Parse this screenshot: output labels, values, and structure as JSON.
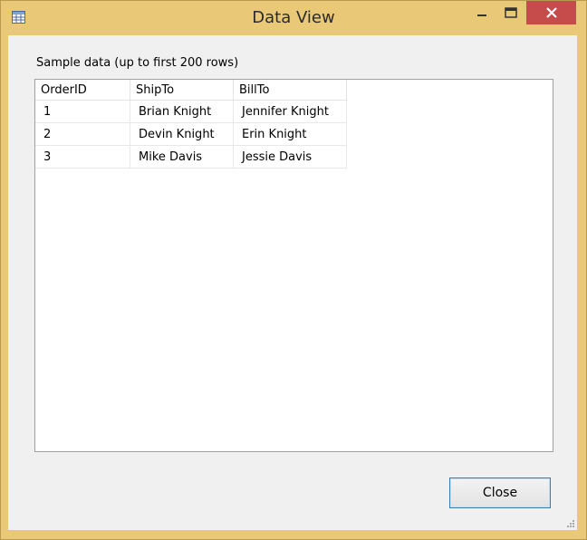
{
  "window": {
    "title": "Data View",
    "frame_color": "#e9c878",
    "close_color": "#c64b4b"
  },
  "content": {
    "caption": "Sample data (up to first 200 rows)"
  },
  "table": {
    "columns": [
      "OrderID",
      "ShipTo",
      "BillTo"
    ],
    "rows": [
      [
        "1",
        "Brian Knight",
        "Jennifer Knight"
      ],
      [
        "2",
        "Devin Knight",
        "Erin Knight"
      ],
      [
        "3",
        "Mike Davis",
        "Jessie Davis"
      ]
    ]
  },
  "buttons": {
    "close_label": "Close"
  },
  "icons": {
    "app": "table-icon",
    "minimize": "minimize-icon",
    "maximize": "maximize-icon",
    "close": "close-icon",
    "grip": "resize-grip-icon"
  }
}
